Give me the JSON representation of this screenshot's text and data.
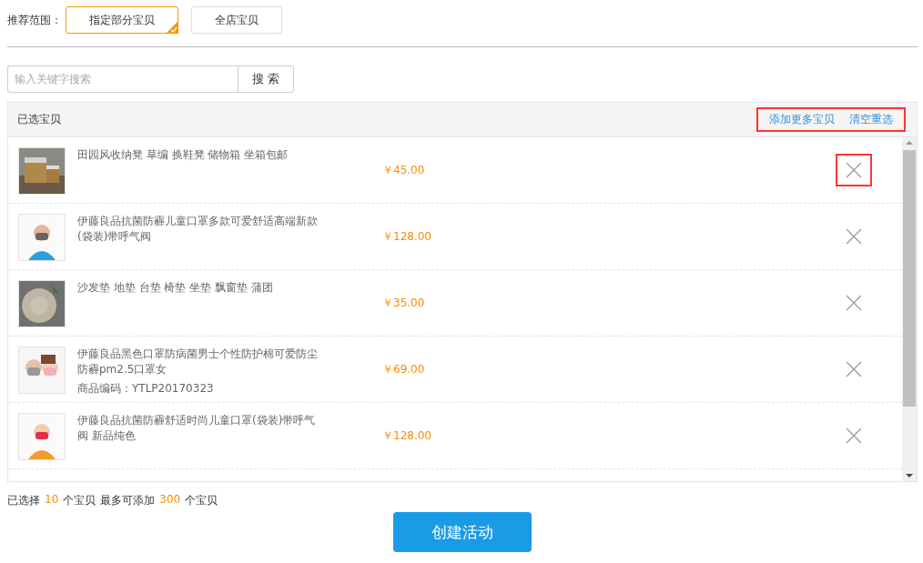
{
  "scope": {
    "label": "推荐范围：",
    "options": [
      {
        "label": "指定部分宝贝",
        "selected": true
      },
      {
        "label": "全店宝贝",
        "selected": false
      }
    ]
  },
  "search": {
    "placeholder": "输入关键字搜索",
    "button": "搜 索"
  },
  "panel": {
    "title": "已选宝贝",
    "actions": [
      "添加更多宝贝",
      "清空重选"
    ],
    "actions_highlighted": true,
    "items": [
      {
        "title": "田园风收纳凳 草编 换鞋凳 储物箱 坐箱包邮",
        "price": "￥45.00",
        "remove_highlighted": true
      },
      {
        "title": "伊藤良品抗菌防霾儿童口罩多款可爱舒适高端新款(袋装)带呼气阀",
        "price": "￥128.00",
        "remove_highlighted": false
      },
      {
        "title": "沙发垫 地垫 台垫 椅垫 坐垫 飘窗垫 蒲团",
        "price": "￥35.00",
        "remove_highlighted": false
      },
      {
        "title": "伊藤良品黑色口罩防病菌男士个性防护棉可爱防尘防霾pm2.5口罩女",
        "code": "商品编码：YTLP20170323",
        "price": "￥69.00",
        "remove_highlighted": false
      },
      {
        "title": "伊藤良品抗菌防霾舒适时尚儿童口罩(袋装)带呼气阀 新品纯色",
        "price": "￥128.00",
        "remove_highlighted": false
      }
    ]
  },
  "footer": {
    "parts": [
      {
        "text": "已选择",
        "accent": false
      },
      {
        "text": "10",
        "accent": true
      },
      {
        "text": "个宝贝",
        "accent": false
      },
      {
        "text": "最多可添加",
        "accent": false
      },
      {
        "text": "300",
        "accent": true
      },
      {
        "text": "个宝贝",
        "accent": false
      }
    ]
  },
  "submit": "创建活动"
}
